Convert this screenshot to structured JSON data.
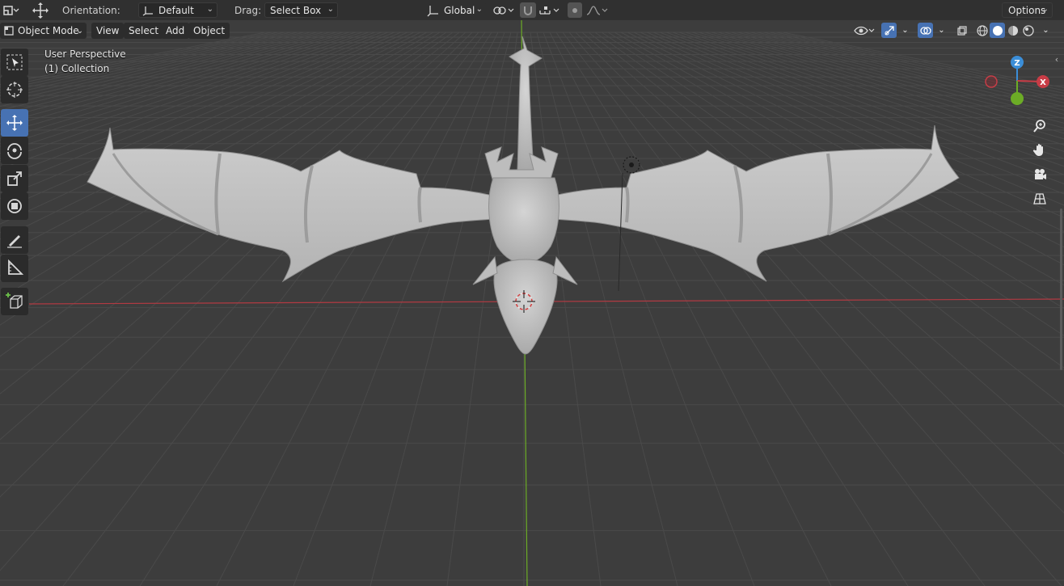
{
  "header": {
    "orientation_label": "Orientation:",
    "orientation_value": "Default",
    "drag_label": "Drag:",
    "drag_value": "Select Box",
    "transform_value": "Global",
    "options_label": "Options"
  },
  "view_header": {
    "mode_value": "Object Mode",
    "menus": [
      "View",
      "Select",
      "Add",
      "Object"
    ]
  },
  "overlay": {
    "perspective": "User Perspective",
    "collection": "(1) Collection"
  },
  "gizmo": {
    "z_label": "Z",
    "x_label": "X"
  },
  "tools": [
    {
      "name": "select-box-tool-icon",
      "active": false
    },
    {
      "name": "cursor-tool-icon",
      "active": false
    },
    {
      "name": "move-tool-icon",
      "active": true
    },
    {
      "name": "rotate-tool-icon",
      "active": false
    },
    {
      "name": "scale-tool-icon",
      "active": false
    },
    {
      "name": "transform-tool-icon",
      "active": false
    },
    {
      "name": "annotate-tool-icon",
      "active": false
    },
    {
      "name": "measure-tool-icon",
      "active": false
    },
    {
      "name": "add-cube-tool-icon",
      "active": false
    }
  ],
  "colors": {
    "background": "#3d3d3d",
    "header": "#303030",
    "accent": "#4772b3",
    "x_axis": "#c83c46",
    "y_axis": "#6cac26",
    "z_axis": "#3b8ed8",
    "model": "#c4c4c4"
  }
}
